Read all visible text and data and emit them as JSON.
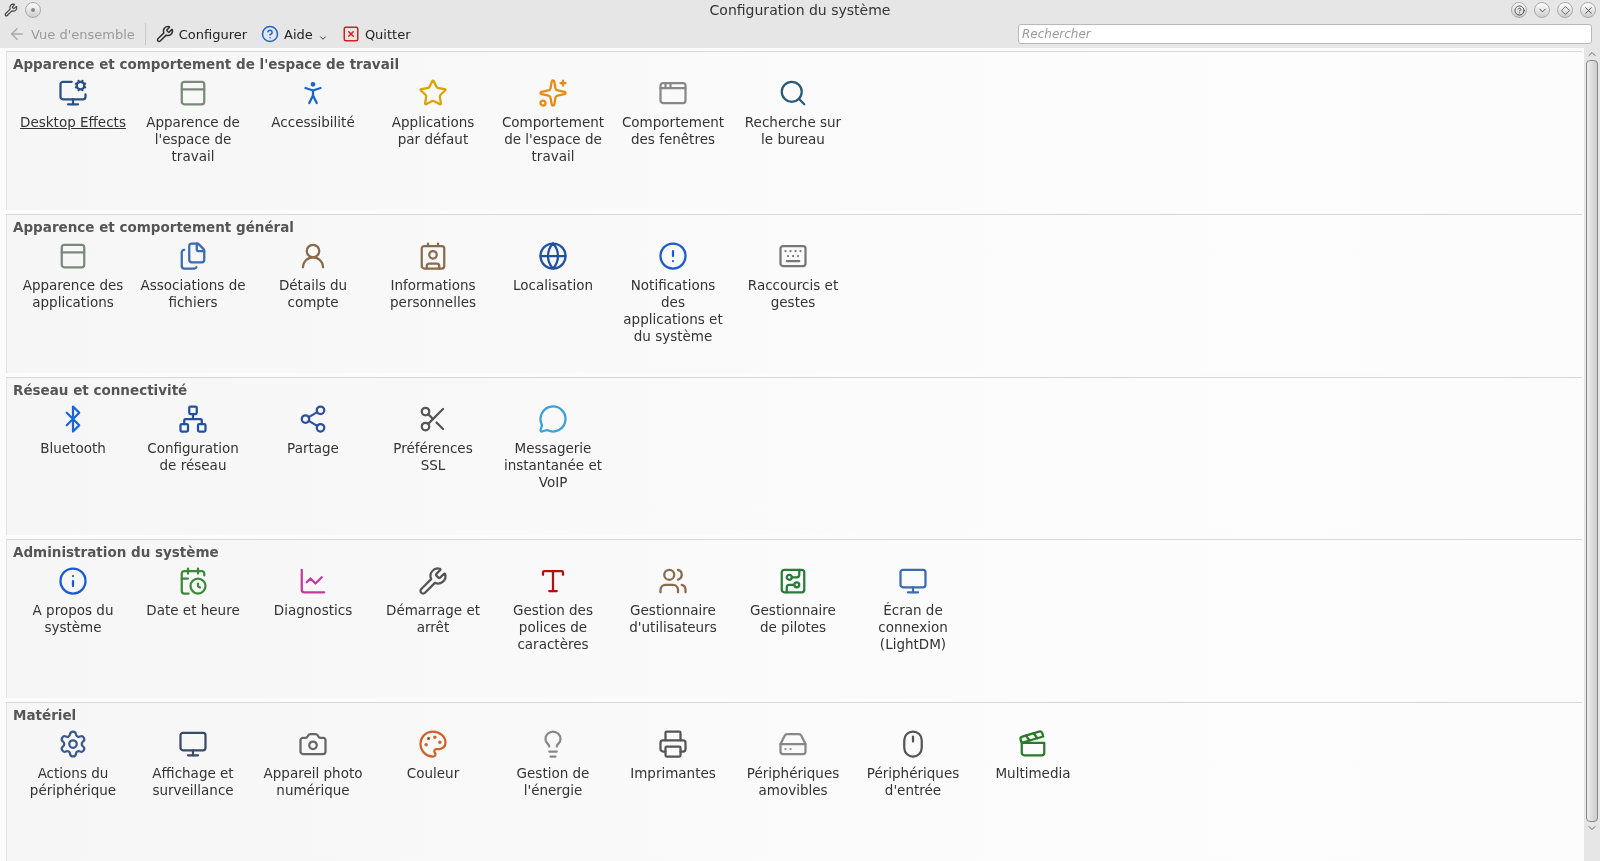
{
  "window": {
    "title": "Configuration du système"
  },
  "toolbar": [
    {
      "label": "Vue d'ensemble",
      "kind": "button",
      "disabled": true
    },
    {
      "label": "Configurer",
      "kind": "button",
      "disabled": false
    },
    {
      "label": "Aide",
      "kind": "menu",
      "disabled": false
    },
    {
      "label": "Quitter",
      "kind": "button",
      "disabled": false
    }
  ],
  "search": {
    "placeholder": "Rechercher"
  },
  "sections": [
    {
      "title": "Apparence et comportement de l'espace de travail",
      "items": [
        {
          "label": "Desktop Effects",
          "hovered": true
        },
        {
          "label": "Apparence de l'espace de travail",
          "hovered": false
        },
        {
          "label": "Accessibilité",
          "hovered": false
        },
        {
          "label": "Applications par défaut",
          "hovered": false
        },
        {
          "label": "Comportement de l'espace de travail",
          "hovered": false
        },
        {
          "label": "Comportement des fenêtres",
          "hovered": false
        },
        {
          "label": "Recherche sur le bureau",
          "hovered": false
        }
      ]
    },
    {
      "title": "Apparence et comportement général",
      "items": [
        {
          "label": "Apparence des applications",
          "hovered": false
        },
        {
          "label": "Associations de fichiers",
          "hovered": false
        },
        {
          "label": "Détails du compte",
          "hovered": false
        },
        {
          "label": "Informations personnelles",
          "hovered": false
        },
        {
          "label": "Localisation",
          "hovered": false
        },
        {
          "label": "Notifications des applications et du système",
          "hovered": false
        },
        {
          "label": "Raccourcis et gestes",
          "hovered": false
        }
      ]
    },
    {
      "title": "Réseau et connectivité",
      "items": [
        {
          "label": "Bluetooth",
          "hovered": false
        },
        {
          "label": "Configuration de réseau",
          "hovered": false
        },
        {
          "label": "Partage",
          "hovered": false
        },
        {
          "label": "Préférences SSL",
          "hovered": false
        },
        {
          "label": "Messagerie instantanée et VoIP",
          "hovered": false
        }
      ]
    },
    {
      "title": "Administration du système",
      "items": [
        {
          "label": "A propos du système",
          "hovered": false
        },
        {
          "label": "Date et heure",
          "hovered": false
        },
        {
          "label": "Diagnostics",
          "hovered": false
        },
        {
          "label": "Démarrage et arrêt",
          "hovered": false
        },
        {
          "label": "Gestion des polices de caractères",
          "hovered": false
        },
        {
          "label": "Gestionnaire d'utilisateurs",
          "hovered": false
        },
        {
          "label": "Gestionnaire de pilotes",
          "hovered": false
        },
        {
          "label": "Écran de connexion (LightDM)",
          "hovered": false
        }
      ]
    },
    {
      "title": "Matériel",
      "items": [
        {
          "label": "Actions du périphérique",
          "hovered": false
        },
        {
          "label": "Affichage et surveillance",
          "hovered": false
        },
        {
          "label": "Appareil photo numérique",
          "hovered": false
        },
        {
          "label": "Couleur",
          "hovered": false
        },
        {
          "label": "Gestion de l'énergie",
          "hovered": false
        },
        {
          "label": "Imprimantes",
          "hovered": false
        },
        {
          "label": "Périphériques amovibles",
          "hovered": false
        },
        {
          "label": "Périphériques d'entrée",
          "hovered": false
        },
        {
          "label": "Multimedia",
          "hovered": false
        }
      ]
    }
  ]
}
